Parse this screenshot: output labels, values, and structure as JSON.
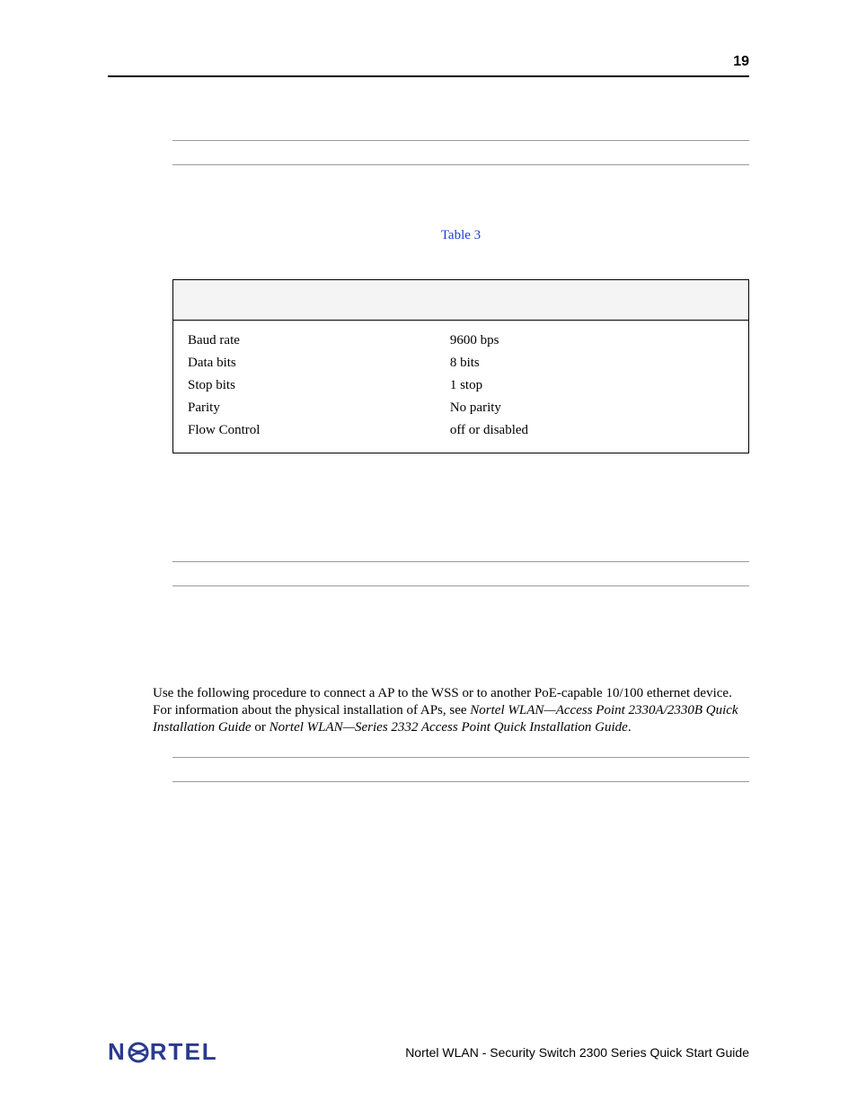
{
  "page_number": "19",
  "table_ref_label": "Table 3",
  "table": {
    "rows": [
      {
        "setting": "Baud rate",
        "value": "9600 bps"
      },
      {
        "setting": "Data bits",
        "value": "8 bits"
      },
      {
        "setting": "Stop bits",
        "value": "1 stop"
      },
      {
        "setting": "Parity",
        "value": "No parity"
      },
      {
        "setting": "Flow Control",
        "value": "off or disabled"
      }
    ]
  },
  "paragraph": {
    "lead": "Use the following procedure to connect a AP to the WSS or to another PoE-capable 10/100 ethernet device. For information about the physical installation of APs, see ",
    "cite1": "Nortel WLAN—Access Point 2330A/2330B Quick Installation Guide",
    "mid": " or ",
    "cite2": "Nortel WLAN—Series 2332 Access Point Quick Installation Guide",
    "tail": "."
  },
  "footer": {
    "doc_title": "Nortel WLAN - Security Switch 2300 Series Quick Start Guide",
    "logo_left": "N",
    "logo_right": "RTEL"
  }
}
